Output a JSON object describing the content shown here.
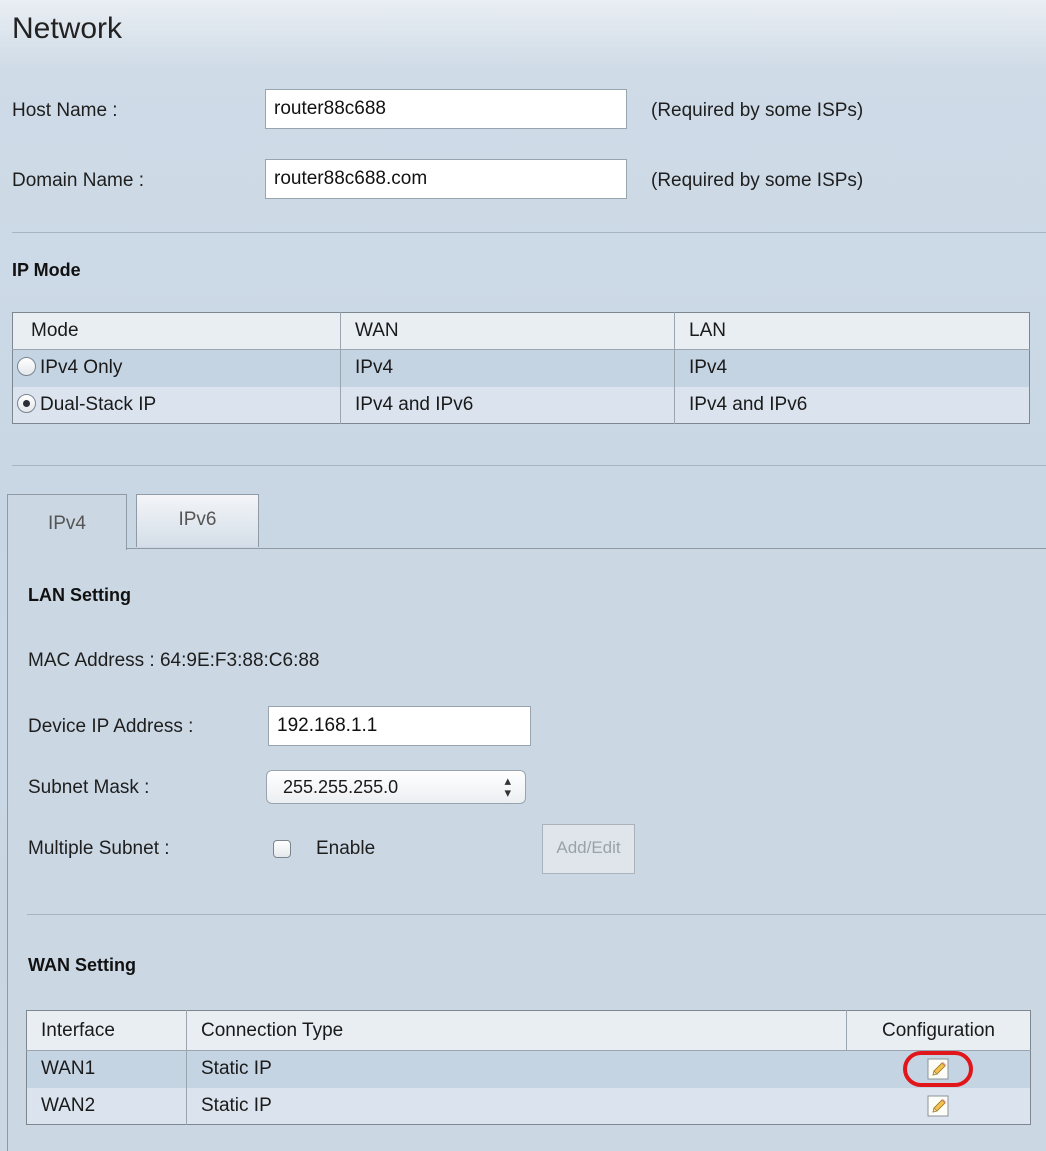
{
  "page": {
    "title": "Network"
  },
  "host": {
    "label": "Host Name :",
    "value": "router88c688",
    "note": "(Required by some ISPs)"
  },
  "domain": {
    "label": "Domain Name :",
    "value": "router88c688.com",
    "note": "(Required by some ISPs)"
  },
  "ip_mode": {
    "heading": "IP Mode",
    "columns": [
      "Mode",
      "WAN",
      "LAN"
    ],
    "rows": [
      {
        "mode": "IPv4 Only",
        "wan": "IPv4",
        "lan": "IPv4",
        "selected": false
      },
      {
        "mode": "Dual-Stack IP",
        "wan": "IPv4 and IPv6",
        "lan": "IPv4 and IPv6",
        "selected": true
      }
    ]
  },
  "tabs": [
    {
      "label": "IPv4",
      "active": true
    },
    {
      "label": "IPv6",
      "active": false
    }
  ],
  "lan": {
    "heading": "LAN Setting",
    "mac_text": "MAC Address : 64:9E:F3:88:C6:88",
    "device_ip_label": "Device IP Address :",
    "device_ip_value": "192.168.1.1",
    "subnet_label": "Subnet Mask :",
    "subnet_value": "255.255.255.0",
    "multi_subnet_label": "Multiple Subnet :",
    "enable_label": "Enable",
    "enable_checked": false,
    "add_edit_label": "Add/Edit"
  },
  "wan": {
    "heading": "WAN Setting",
    "columns": [
      "Interface",
      "Connection Type",
      "Configuration"
    ],
    "rows": [
      {
        "interface": "WAN1",
        "type": "Static IP",
        "highlighted": true
      },
      {
        "interface": "WAN2",
        "type": "Static IP",
        "highlighted": false
      }
    ]
  },
  "icons": {
    "edit": "pencil-edit-icon"
  },
  "colors": {
    "highlight": "#e0161b",
    "row_selected": "#c5d4e3",
    "row_alt": "#dbe4ee"
  }
}
